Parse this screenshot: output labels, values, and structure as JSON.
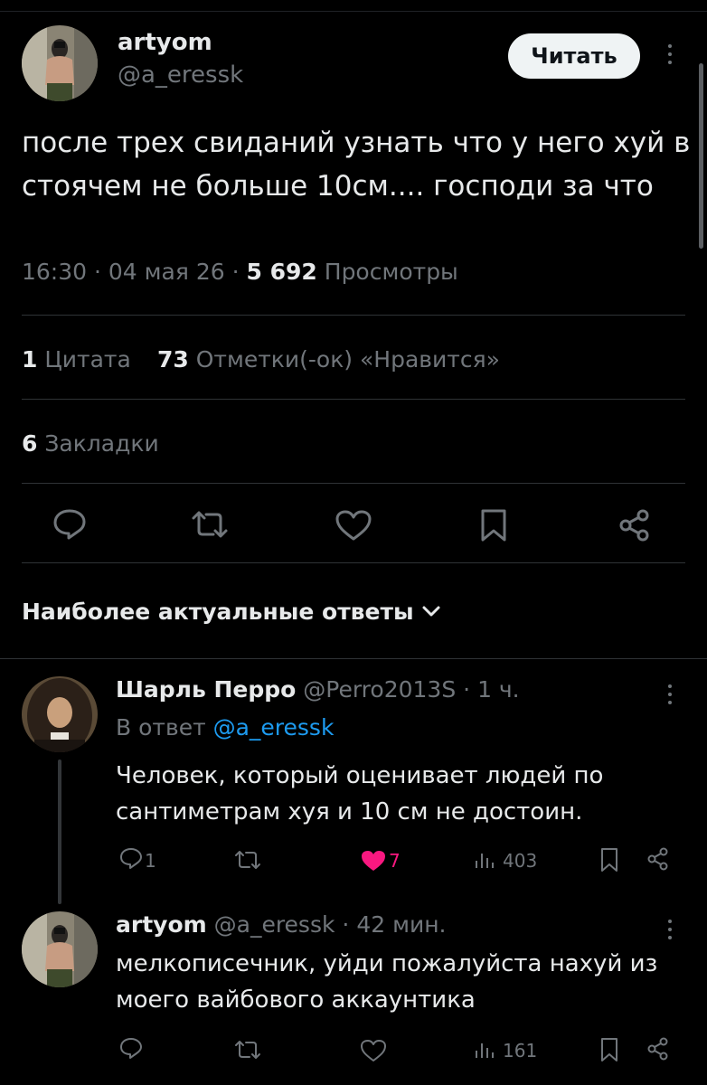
{
  "tweet": {
    "author_name": "artyom",
    "author_handle": "@a_eressk",
    "follow_label": "Читать",
    "text": "после трех свиданий узнать что у него хуй в стоячем не больше 10см.... господи за что",
    "time": "16:30",
    "date": "04 мая 26",
    "views_count": "5 692",
    "views_label": "Просмотры",
    "quotes_count": "1",
    "quotes_label": "Цитата",
    "likes_count": "73",
    "likes_label": "Отметки(-ок) «Нравится»",
    "bookmarks_count": "6",
    "bookmarks_label": "Закладки"
  },
  "replies_section": {
    "title": "Наиболее актуальные ответы"
  },
  "reply1": {
    "author_name": "Шарль Перро",
    "author_handle": "@Perro2013S",
    "time": "1 ч.",
    "replying_to_prefix": "В ответ",
    "replying_to_handle": "@a_eressk",
    "text": "Человек, который оценивает людей по сантиметрам хуя и 10 см не достоин.",
    "replies_count": "1",
    "likes_count": "7",
    "views_count": "403",
    "liked": true
  },
  "reply2": {
    "author_name": "artyom",
    "author_handle": "@a_eressk",
    "time": "42 мин.",
    "text": "мелкописечник, уйди пожалуйста нахуй из моего вайбового аккаунтика",
    "views_count": "161"
  },
  "colors": {
    "background": "#000000",
    "text_primary": "#e7e9ea",
    "text_secondary": "#71767b",
    "link": "#1d9bf0",
    "like": "#f91880",
    "divider": "#2f3336"
  },
  "icons": [
    "reply-icon",
    "retweet-icon",
    "like-icon",
    "bookmark-icon",
    "share-icon",
    "views-icon",
    "more-icon",
    "chevron-down-icon"
  ]
}
